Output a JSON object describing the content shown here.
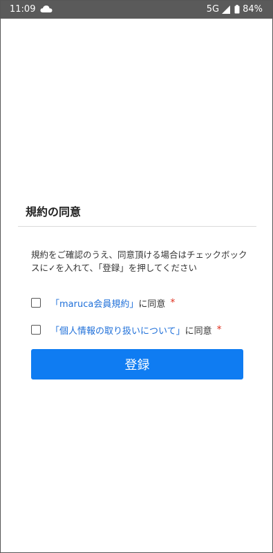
{
  "status_bar": {
    "time": "11:09",
    "network": "5G",
    "battery": "84%",
    "icons": [
      "cloud-icon",
      "signal-icon",
      "battery-icon"
    ]
  },
  "terms": {
    "title": "規約の同意",
    "instruction": "規約をご確認のうえ、同意頂ける場合はチェックボックスに✓を入れて、「登録」を押してください",
    "items": [
      {
        "link_text": "「maruca会員規約」",
        "suffix": "に同意",
        "required_mark": "*",
        "checked": false
      },
      {
        "link_text": "「個人情報の取り扱いについて」",
        "suffix": "に同意",
        "required_mark": "*",
        "checked": false
      }
    ],
    "register_label": "登録"
  },
  "colors": {
    "accent": "#0f7cf2",
    "link": "#1e6fd9",
    "required": "#e0301e",
    "status_bar": "#5a5a5a"
  }
}
